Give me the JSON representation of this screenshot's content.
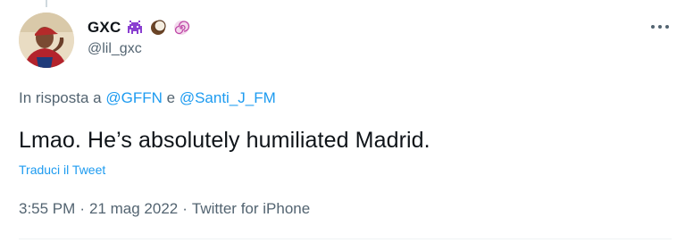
{
  "author": {
    "display_name": "GXC",
    "handle": "@lil_gxc",
    "badges": [
      "space-invader-icon",
      "coconut-icon",
      "spiral-shell-icon"
    ]
  },
  "reply": {
    "prefix": "In risposta a",
    "mention_1": "@GFFN",
    "joiner": "e",
    "mention_2": "@Santi_J_FM"
  },
  "tweet": {
    "text": "Lmao. He’s absolutely humiliated Madrid.",
    "translate_label": "Traduci il Tweet"
  },
  "meta": {
    "time": "3:55 PM",
    "date": "21 mag 2022",
    "source": "Twitter for iPhone",
    "separator": "·"
  },
  "colors": {
    "accent": "#1d9bf0",
    "secondary_text": "#536471",
    "primary_text": "#0f1419",
    "divider": "#eff3f4"
  },
  "icons": {
    "more": "more-options-icon",
    "avatar": "avatar"
  }
}
